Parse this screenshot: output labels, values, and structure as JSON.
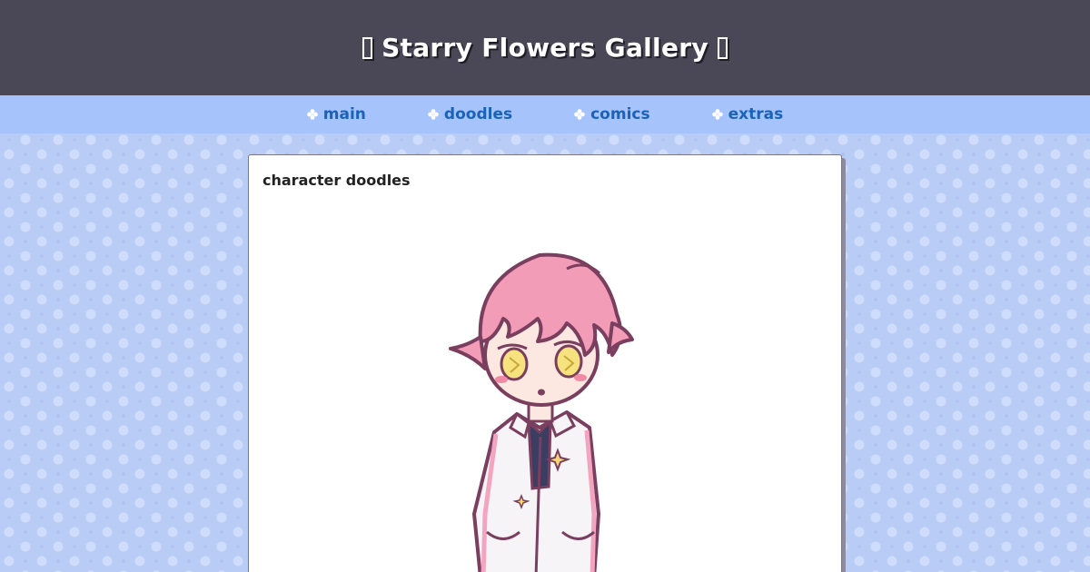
{
  "header": {
    "title": "Starry Flowers Gallery"
  },
  "nav": {
    "items": [
      {
        "label": "main",
        "icon": "flower-icon"
      },
      {
        "label": "doodles",
        "icon": "flower-icon"
      },
      {
        "label": "comics",
        "icon": "flower-icon"
      },
      {
        "label": "extras",
        "icon": "flower-icon"
      }
    ]
  },
  "main": {
    "heading": "character doodles",
    "image": {
      "subject": "character-doodle-illustration"
    }
  },
  "colors": {
    "header_bg": "#4a4856",
    "nav_bg": "#a6c3fb",
    "nav_link": "#1a63b8",
    "page_bg": "#b8ccf5",
    "card_bg": "#ffffff",
    "hair": "#f39cb8",
    "outline": "#7a3f5e"
  }
}
